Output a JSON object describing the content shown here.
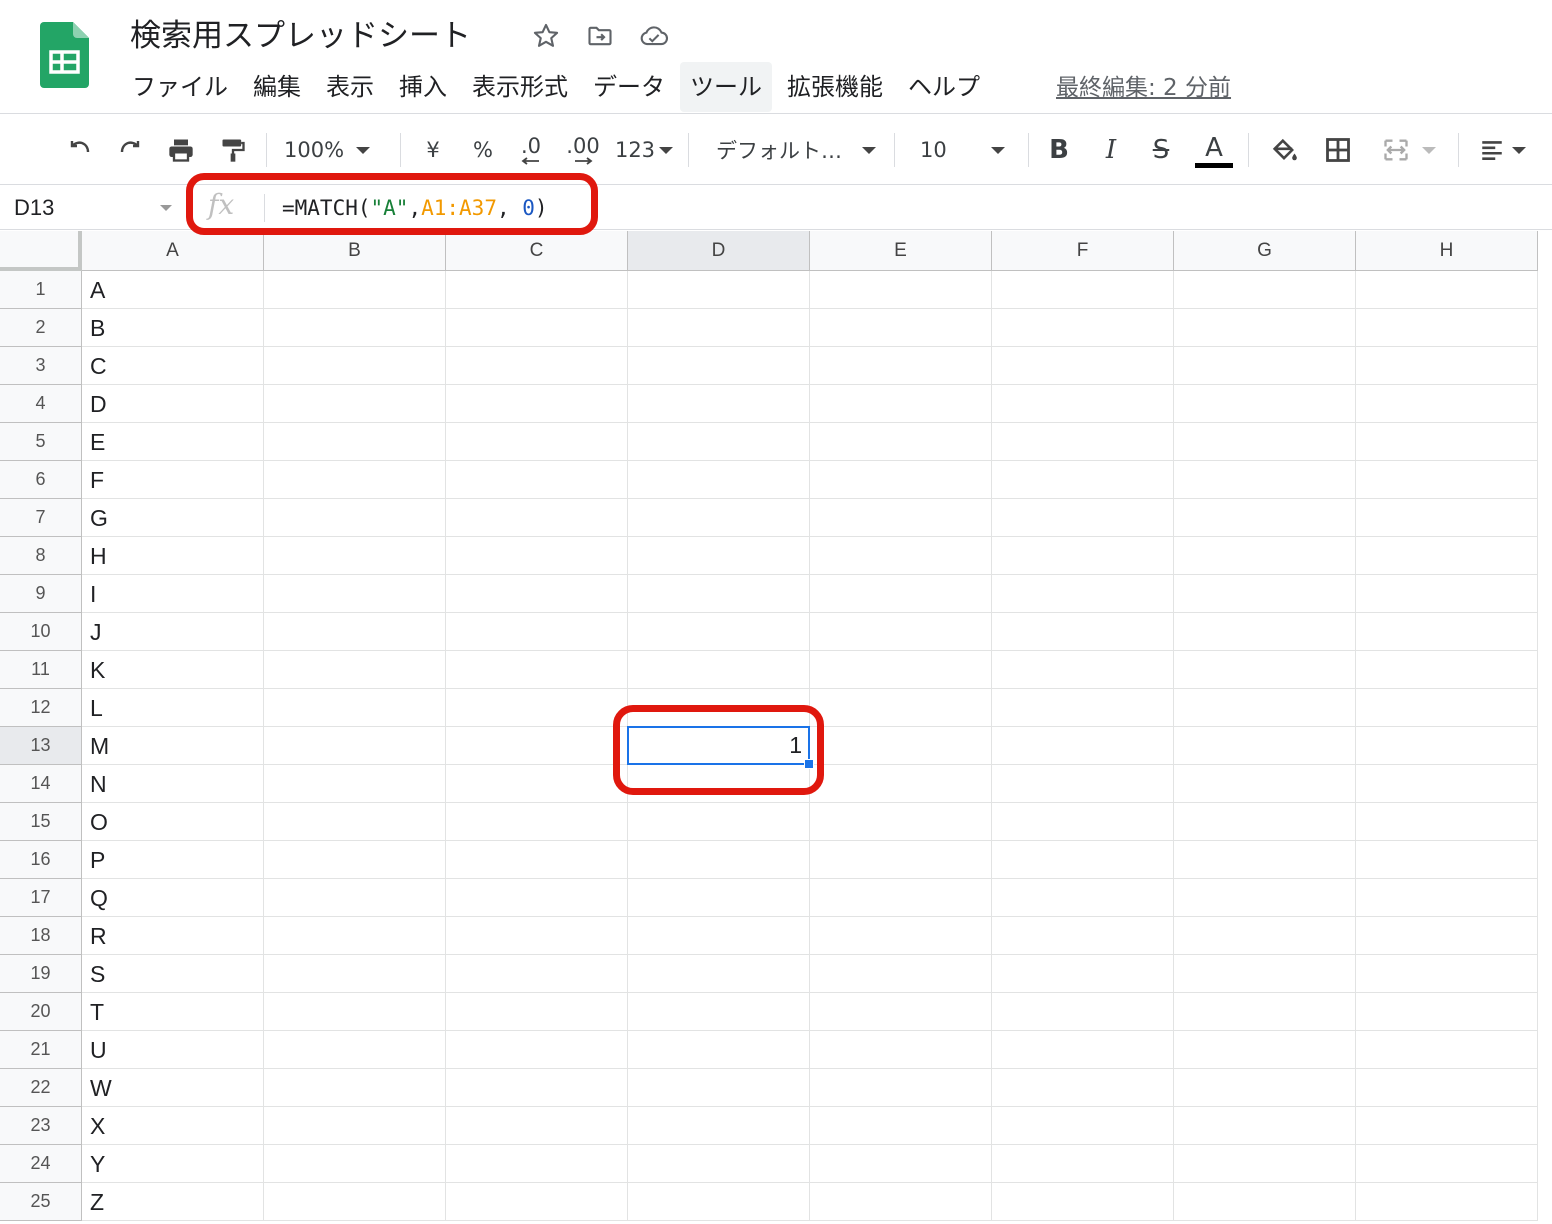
{
  "document": {
    "title": "検索用スプレッドシート",
    "last_edit": "最終編集: 2 分前"
  },
  "menu": [
    "ファイル",
    "編集",
    "表示",
    "挿入",
    "表示形式",
    "データ",
    "ツール",
    "拡張機能",
    "ヘルプ"
  ],
  "active_menu": "ツール",
  "toolbar": {
    "zoom": "100%",
    "currency": "¥",
    "percent": "%",
    "decrease_decimal": ".0",
    "increase_decimal": ".00",
    "more_formats": "123",
    "font": "デフォルト…",
    "font_size": "10",
    "bold": "B",
    "italic": "I",
    "strikethrough": "S",
    "text_color": "A"
  },
  "formula_bar": {
    "cell_ref": "D13",
    "fx_label": "fx",
    "formula_parts": {
      "prefix": "=MATCH(",
      "string_arg": "\"A\"",
      "comma1": ",",
      "range_arg": "A1:A37",
      "comma2": ", ",
      "number_arg": "0",
      "suffix": ")"
    }
  },
  "grid": {
    "columns": [
      "A",
      "B",
      "C",
      "D",
      "E",
      "F",
      "G",
      "H"
    ],
    "selected_column": "D",
    "selected_row": 13,
    "rows": [
      {
        "num": "1",
        "a": "A"
      },
      {
        "num": "2",
        "a": "B"
      },
      {
        "num": "3",
        "a": "C"
      },
      {
        "num": "4",
        "a": "D"
      },
      {
        "num": "5",
        "a": "E"
      },
      {
        "num": "6",
        "a": "F"
      },
      {
        "num": "7",
        "a": "G"
      },
      {
        "num": "8",
        "a": "H"
      },
      {
        "num": "9",
        "a": "I"
      },
      {
        "num": "10",
        "a": "J"
      },
      {
        "num": "11",
        "a": "K"
      },
      {
        "num": "12",
        "a": "L"
      },
      {
        "num": "13",
        "a": "M"
      },
      {
        "num": "14",
        "a": "N"
      },
      {
        "num": "15",
        "a": "O"
      },
      {
        "num": "16",
        "a": "P"
      },
      {
        "num": "17",
        "a": "Q"
      },
      {
        "num": "18",
        "a": "R"
      },
      {
        "num": "19",
        "a": "S"
      },
      {
        "num": "20",
        "a": "T"
      },
      {
        "num": "21",
        "a": "U"
      },
      {
        "num": "22",
        "a": "W"
      },
      {
        "num": "23",
        "a": "X"
      },
      {
        "num": "24",
        "a": "Y"
      },
      {
        "num": "25",
        "a": "Z"
      }
    ],
    "selected_cell_value": "1"
  },
  "colors": {
    "sheets_green": "#23a566",
    "selection_blue": "#1a73e8",
    "highlight_red": "#e0180e"
  }
}
